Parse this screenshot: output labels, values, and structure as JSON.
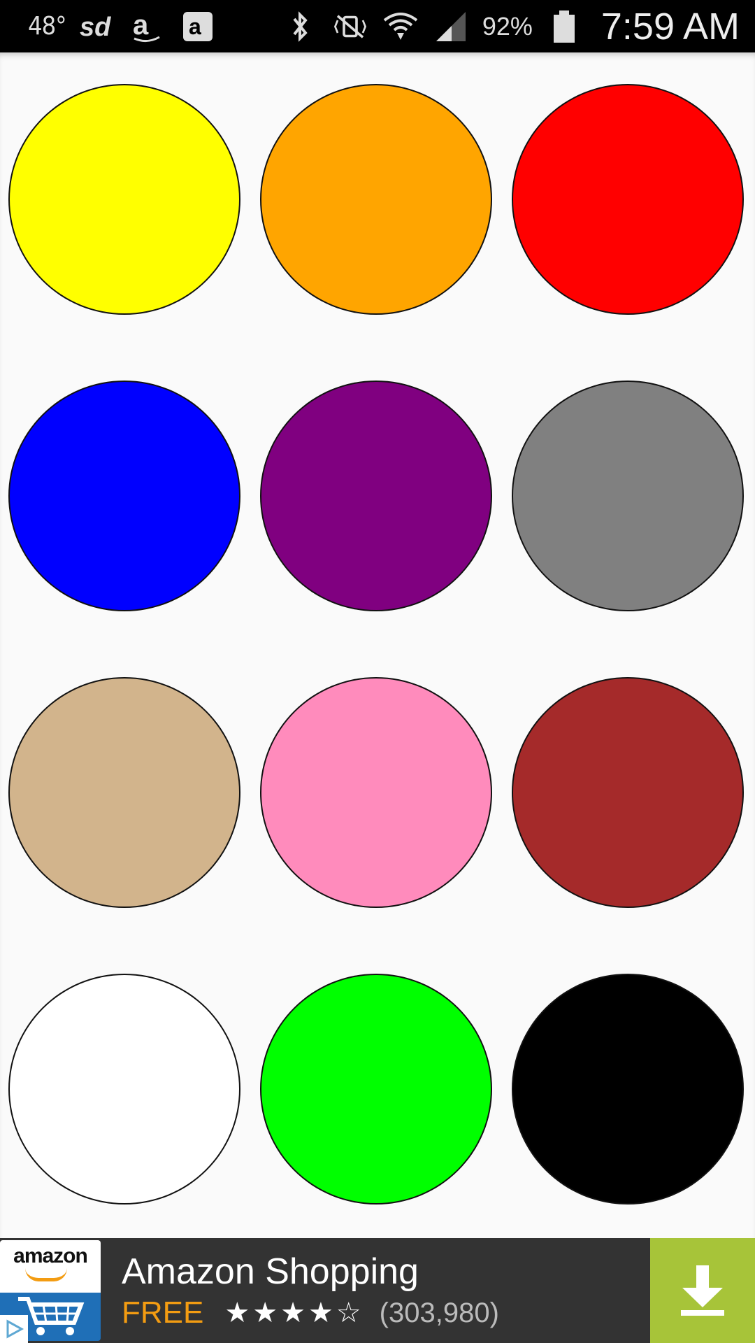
{
  "status_bar": {
    "temperature": "48°",
    "battery_percent": "92%",
    "time": "7:59 AM",
    "icons": [
      "sd-icon",
      "amazon-icon",
      "amazon-app-icon",
      "bluetooth-icon",
      "vibrate-icon",
      "wifi-icon",
      "signal-icon",
      "battery-icon"
    ]
  },
  "colors": [
    {
      "name": "yellow",
      "hex": "#FFFF00"
    },
    {
      "name": "orange",
      "hex": "#FFA500"
    },
    {
      "name": "red",
      "hex": "#FF0000"
    },
    {
      "name": "blue",
      "hex": "#0000FF"
    },
    {
      "name": "purple",
      "hex": "#800080"
    },
    {
      "name": "gray",
      "hex": "#808080"
    },
    {
      "name": "tan",
      "hex": "#D2B48C"
    },
    {
      "name": "pink",
      "hex": "#FF8BBC"
    },
    {
      "name": "brown",
      "hex": "#A52A2A"
    },
    {
      "name": "white",
      "hex": "#FFFFFF"
    },
    {
      "name": "green",
      "hex": "#00FF00"
    },
    {
      "name": "black",
      "hex": "#000000"
    }
  ],
  "ad": {
    "logo_text": "amazon",
    "title": "Amazon Shopping",
    "price": "FREE",
    "rating_stars": "★★★★☆",
    "rating": 4,
    "review_count": "(303,980)",
    "accent_color": "#A7C439"
  }
}
